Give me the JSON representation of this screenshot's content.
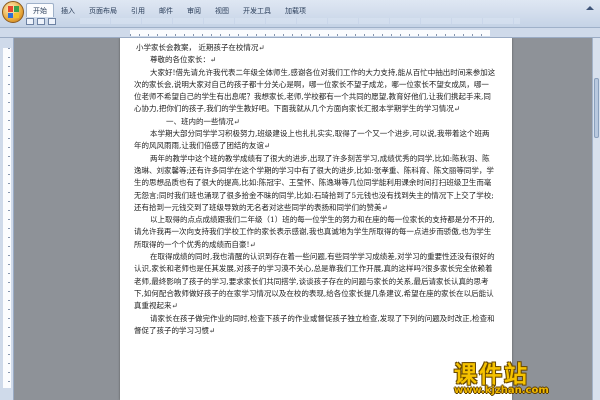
{
  "ribbon": {
    "tabs": [
      "开始",
      "插入",
      "页面布局",
      "引用",
      "邮件",
      "审阅",
      "视图",
      "开发工具",
      "加载项"
    ]
  },
  "document": {
    "paragraphs": [
      "小学家长会教案，  近期孩子在校情况↵",
      "尊敬的各位家长：↵",
      "大家好!借先请允许我代表二年级全体师生,感谢各位对我们工作的大力支持,能从百忙中抽出时间来参加这次的家长会,说明大家对自己的孩子都十分关心是啊，哪一位家长不望子成龙，哪一位家长不望女成凤，哪一位老师不希望自己的学生有出息呢？我想家长,老师,学校都有一个共同的愿望,教育好他们,让我们携起手来,同心协力,把你们的孩子,我们的学生教好吧。下面我就从几个方面向家长汇报本学期学生的学习情况↵",
      "一、班内的一些情况↵",
      "本学期大部分同学学习积极努力,班级建设上也扎扎实实,取得了一个又一个进步,可以说,我带着这个班两年的风风雨雨,让我们倍感了团结的友谊↵",
      "两年的教学中这个班的教学成绩有了很大的进步,出现了许多刻苦学习,成绩优秀的同学,比如:陈秋羽、陈逸琳、刘家馨等;还有许多同学在这个学期的学习中有了很大的进步,比如:张孝重、陈科育、陈文丽等同学，学生的思想品质也有了很大的提高,比如:陈冠宇、王莹怀、陈逸琳等几位同学能利用课余时间打扫班级卫生而毫无怨言;同时我们班也涌现了很多拾金不昧的同学,比如:石琦拾到了5元钱也没有找到失主的情况下上交了学校;还有拾到一元钱交到了班级导致的无名者对这些同学的表扬和同学们的赞美↵",
      "以上取得的点点成绩跟我们二年级（1）班的每一位学生的努力和在座的每一位家长的支持都是分不开的,请允许我再一次向支持我们学校工作的家长表示感谢,我也真诚地为学生所取得的每一点进步而骄傲,也为学生所取得的一个个优秀的成绩而自豪!↵",
      "在取得成绩的同时,我也清醒的认识到存在着一些问题,有些同学学习成绩差,对学习的重要性还没有很好的认识,家长和老师也是任其发展,对孩子的学习漠不关心,总是靠我们工作开展,真的这样吗?很多家长完全依赖着老师,最终影响了孩子的学习,要求家长们共同搭学,谈谈孩子存在的问题与家长的关系,最后请家长认真的思考下,如何配合教师做好孩子的在家学习情况以及在校的表现,给各位家长提几条建议,希望在座的家长在以后能认真重视起来↵",
      "请家长在孩子做完作业的同时,检查下孩子的作业或督促孩子独立检查,发现了下列的问题及时改正,检查和督促了孩子的学习习惯↵"
    ]
  },
  "watermark": {
    "main": "课件站",
    "url": "www.kjzhan.com"
  },
  "colors": {
    "ribbon_top": "#dfe7f3",
    "page": "#ffffff",
    "workspace": "#8e9298",
    "paragraph_mark": "#3b6fd6",
    "watermark": "#f5c200"
  }
}
